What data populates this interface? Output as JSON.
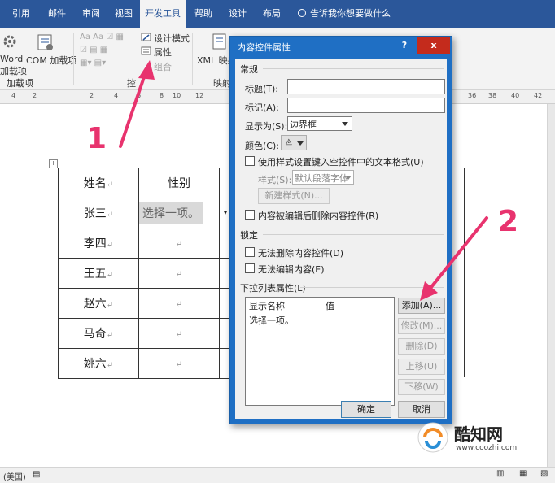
{
  "tabs": [
    {
      "label": "引用"
    },
    {
      "label": "邮件"
    },
    {
      "label": "审阅"
    },
    {
      "label": "视图"
    },
    {
      "label": "开发工具",
      "active": true
    },
    {
      "label": "帮助"
    },
    {
      "label": "设计"
    },
    {
      "label": "布局"
    }
  ],
  "tell_me": "告诉我你想要做什么",
  "ribbon": {
    "word_addins": "Word",
    "word_addins2": "加载项",
    "com_addins": "COM 加载项",
    "addins_group": "加载项",
    "design_mode": "设计模式",
    "properties": "属性",
    "group": "组合",
    "controls_group": "控",
    "xml_mapping": "XML 映射",
    "mapping_group": "映射"
  },
  "ruler_marks": [
    "4",
    "2",
    "2",
    "4",
    "6",
    "8",
    "10",
    "12",
    "36",
    "38",
    "40",
    "42"
  ],
  "table": {
    "header": [
      "姓名",
      "性别"
    ],
    "rows": [
      "张三",
      "李四",
      "王五",
      "赵六",
      "马奇",
      "姚六"
    ],
    "first_cell_value": "选择一项。",
    "mark": "↵"
  },
  "status": {
    "language": "(美国)"
  },
  "dialog": {
    "title": "内容控件属性",
    "help": "?",
    "close": "x",
    "general": "常规",
    "title_label": "标题(T):",
    "tag_label": "标记(A):",
    "show_as_label": "显示为(S):",
    "show_as_value": "边界框",
    "color_label": "颜色(C):",
    "use_style": "使用样式设置键入空控件中的文本格式(U)",
    "style_label": "样式(S):",
    "style_value": "默认段落字体",
    "new_style": "新建样式(N)...",
    "remove_on_edit": "内容被编辑后删除内容控件(R)",
    "locking": "锁定",
    "cannot_delete": "无法删除内容控件(D)",
    "cannot_edit": "无法编辑内容(E)",
    "dropdown_props": "下拉列表属性(L)",
    "col_display": "显示名称",
    "col_value": "值",
    "list_item": "选择一项。",
    "add": "添加(A)...",
    "modify": "修改(M)...",
    "delete": "删除(D)",
    "move_up": "上移(U)",
    "move_down": "下移(W)",
    "ok": "确定",
    "cancel": "取消"
  },
  "annotations": {
    "one": "1",
    "two": "2"
  },
  "watermark": {
    "name": "酷知网",
    "url": "www.coozhi.com"
  },
  "colors": {
    "accent": "#2b579a",
    "arrow": "#e8336e",
    "dialog_title": "#1f6fc4",
    "close": "#c42b1c"
  }
}
